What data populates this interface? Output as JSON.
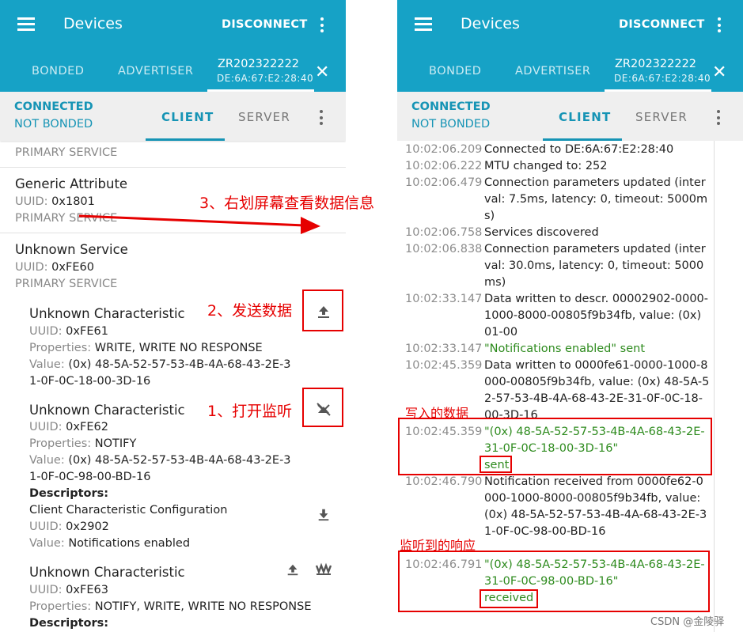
{
  "app": {
    "title": "Devices",
    "disconnect_label": "DISCONNECT",
    "tabs": {
      "bonded": "BONDED",
      "advertiser": "ADVERTISER"
    },
    "device": {
      "name": "ZR202322222",
      "address": "DE:6A:67:E2:28:40"
    },
    "status": {
      "connected": "CONNECTED",
      "bond": "NOT BONDED"
    },
    "subtabs": {
      "client": "CLIENT",
      "server": "SERVER"
    },
    "accent_color": "#16a2c6"
  },
  "left": {
    "partial_service_type": "PRIMARY SERVICE",
    "generic_attribute": {
      "name": "Generic Attribute",
      "uuid_label": "UUID:",
      "uuid": "0x1801",
      "type": "PRIMARY SERVICE"
    },
    "unknown_service": {
      "name": "Unknown Service",
      "uuid_label": "UUID:",
      "uuid": "0xFE60",
      "type": "PRIMARY SERVICE"
    },
    "char1": {
      "name": "Unknown Characteristic",
      "uuid_label": "UUID:",
      "uuid": "0xFE61",
      "props_label": "Properties:",
      "props": "WRITE, WRITE NO RESPONSE",
      "value_label": "Value:",
      "value_line1": "(0x) 48-5A-52-57-53-4B-4A-68-43-2E-3",
      "value_line2": "1-0F-0C-18-00-3D-16",
      "icon": "upload-icon"
    },
    "char2": {
      "name": "Unknown Characteristic",
      "uuid_label": "UUID:",
      "uuid": "0xFE62",
      "props_label": "Properties:",
      "props": "NOTIFY",
      "value_label": "Value:",
      "value_line1": "(0x) 48-5A-52-57-53-4B-4A-68-43-2E-3",
      "value_line2": "1-0F-0C-98-00-BD-16",
      "descriptors_label": "Descriptors:",
      "descriptor": {
        "name": "Client Characteristic Configuration",
        "uuid_label": "UUID:",
        "uuid": "0x2902",
        "value_label": "Value:",
        "value": "Notifications enabled"
      },
      "icon": "notifications-off-icon"
    },
    "char3": {
      "name": "Unknown Characteristic",
      "uuid_label": "UUID:",
      "uuid": "0xFE63",
      "props_label": "Properties:",
      "props": "NOTIFY, WRITE, WRITE NO RESPONSE",
      "descriptors_label": "Descriptors:"
    }
  },
  "log": [
    {
      "time": "10:02:06.209",
      "msg": "Connected to DE:6A:67:E2:28:40"
    },
    {
      "time": "10:02:06.222",
      "msg": "MTU changed to: 252"
    },
    {
      "time": "10:02:06.479",
      "msg": "Connection parameters updated (interval: 7.5ms, latency: 0, timeout: 5000ms)"
    },
    {
      "time": "10:02:06.758",
      "msg": "Services discovered"
    },
    {
      "time": "10:02:06.838",
      "msg": "Connection parameters updated (interval: 30.0ms, latency: 0, timeout: 5000ms)"
    },
    {
      "time": "10:02:33.147",
      "msg": "Data written to descr. 00002902-0000-1000-8000-00805f9b34fb, value: (0x) 01-00"
    },
    {
      "time": "10:02:33.147",
      "msg": "\"Notifications enabled\" sent"
    },
    {
      "time": "10:02:45.359",
      "msg": "Data written to 0000fe61-0000-1000-8000-00805f9b34fb, value: (0x) 48-5A-52-57-53-4B-4A-68-43-2E-31-0F-0C-18-00-3D-16"
    },
    {
      "time": "10:02:45.359",
      "msg": "\"(0x) 48-5A-52-57-53-4B-4A-68-43-2E-31-0F-0C-18-00-3D-16\"",
      "suffix": "sent"
    },
    {
      "time": "10:02:46.790",
      "msg": "Notification received from 0000fe62-0000-1000-8000-00805f9b34fb, value: (0x) 48-5A-52-57-53-4B-4A-68-43-2E-31-0F-0C-98-00-BD-16"
    },
    {
      "time": "10:02:46.791",
      "msg": "\"(0x) 48-5A-52-57-53-4B-4A-68-43-2E-31-0F-0C-98-00-BD-16\"",
      "suffix": "received"
    }
  ],
  "annotations": {
    "swipe": "3、右划屏幕查看数据信息",
    "send": "2、发送数据",
    "listen": "1、打开监听",
    "written": "写入的数据",
    "response": "监听到的响应"
  },
  "watermark": "CSDN @金陵驿"
}
